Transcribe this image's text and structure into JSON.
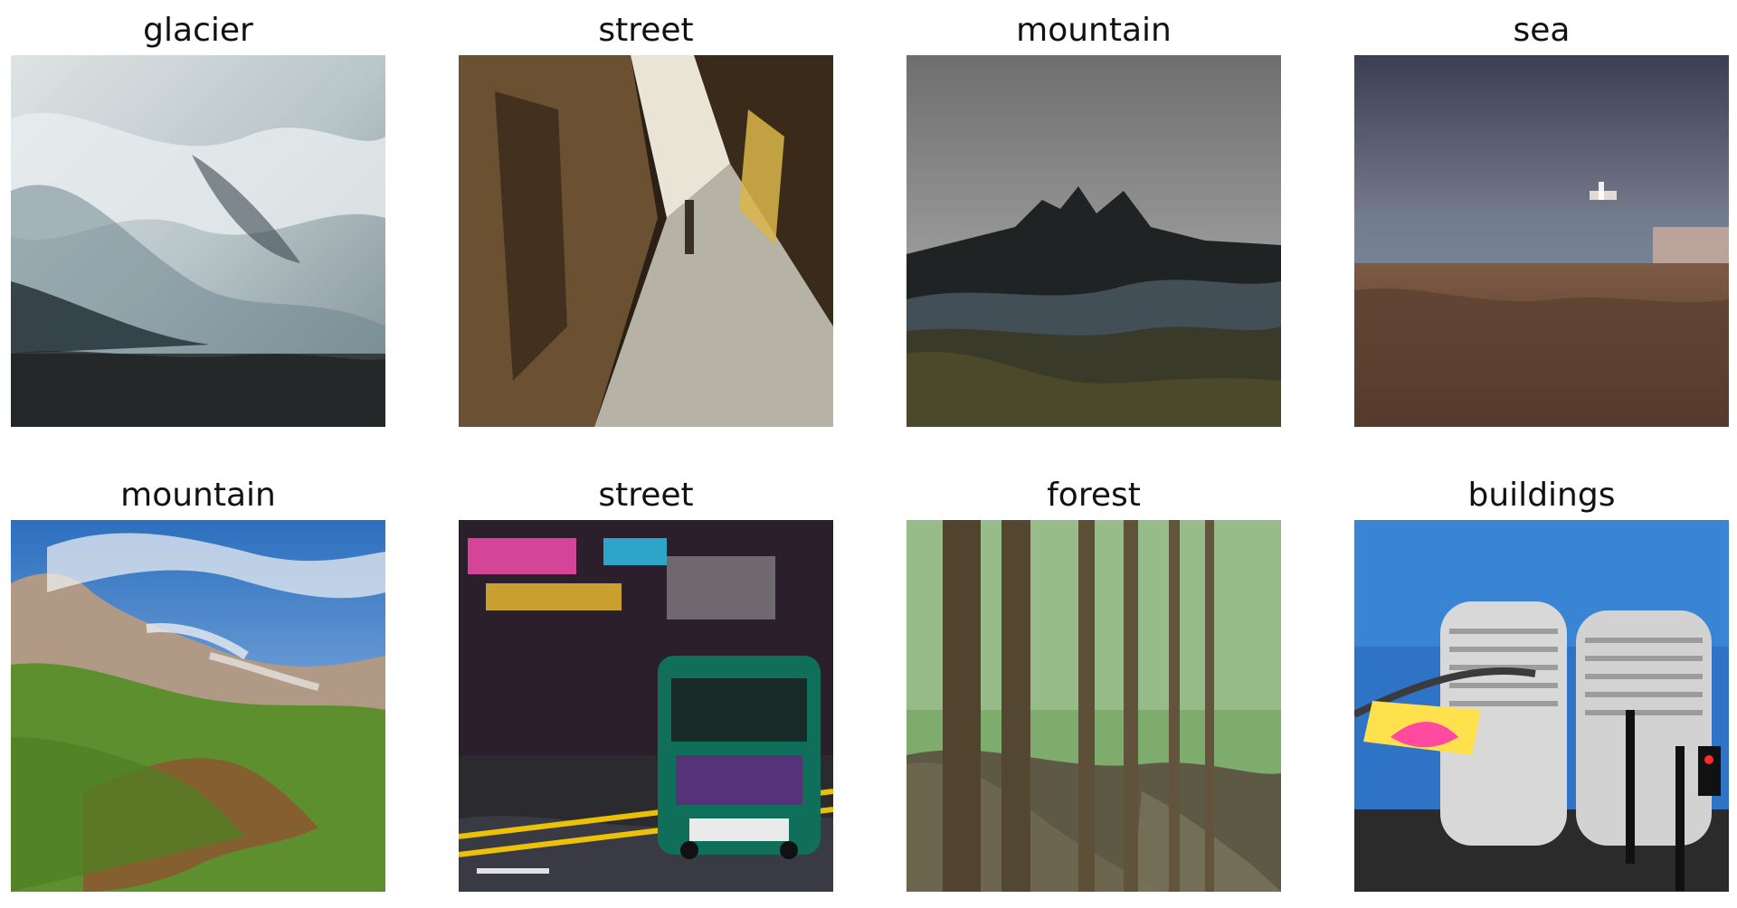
{
  "panels": [
    {
      "label": "glacier"
    },
    {
      "label": "street"
    },
    {
      "label": "mountain"
    },
    {
      "label": "sea"
    },
    {
      "label": "mountain"
    },
    {
      "label": "street"
    },
    {
      "label": "forest"
    },
    {
      "label": "buildings"
    }
  ]
}
